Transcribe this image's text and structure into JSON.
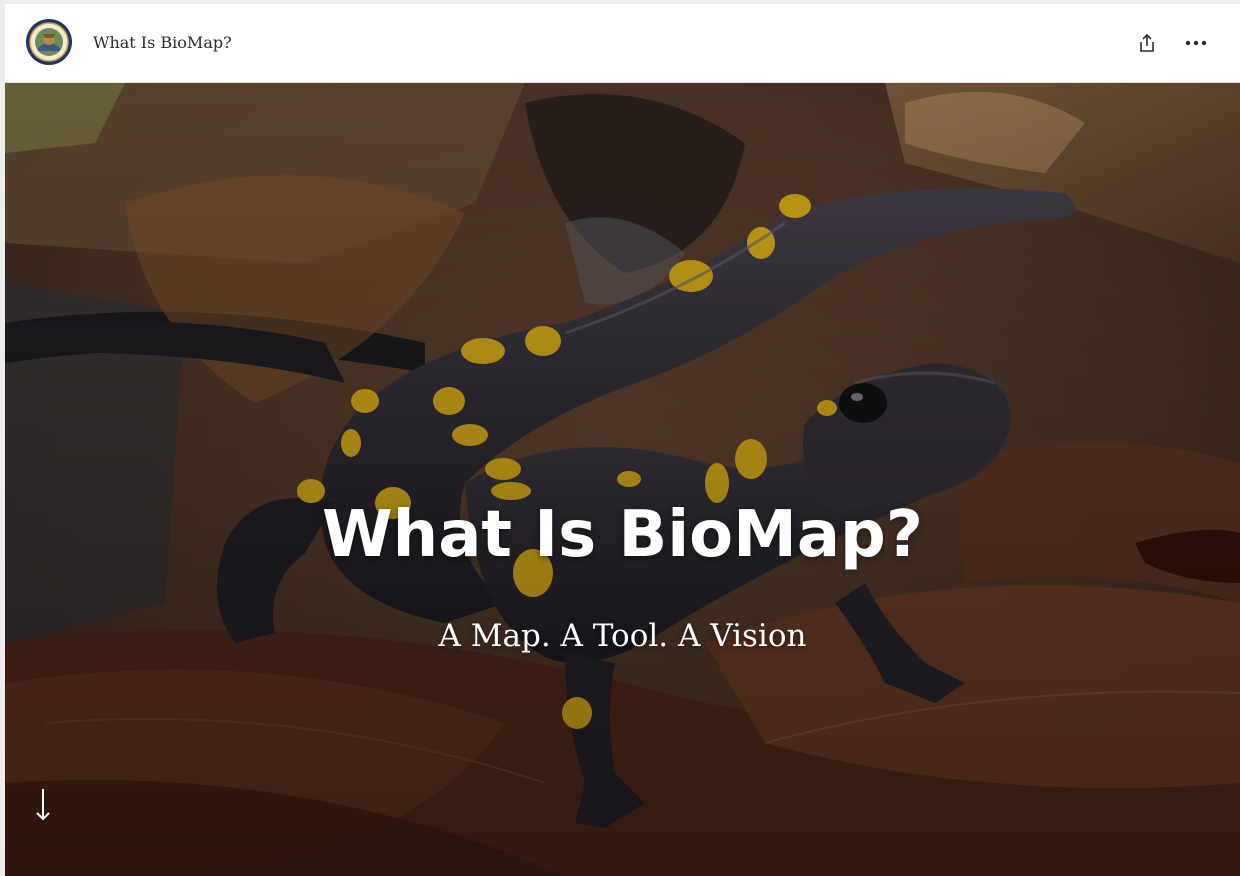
{
  "header": {
    "title": "What Is BioMap?",
    "logo_icon": "massachusetts-seal-logo",
    "share_icon": "share-icon",
    "more_icon": "more-options-icon"
  },
  "hero": {
    "title": "What Is BioMap?",
    "subtitle": "A Map. A Tool. A Vision",
    "image_subject": "spotted-salamander-photo",
    "scroll_icon": "arrow-down-icon"
  },
  "colors": {
    "header_bg": "#ffffff",
    "text_dark": "#2b2b2b",
    "hero_text": "#ffffff",
    "salamander_spot": "#e8b81c"
  }
}
